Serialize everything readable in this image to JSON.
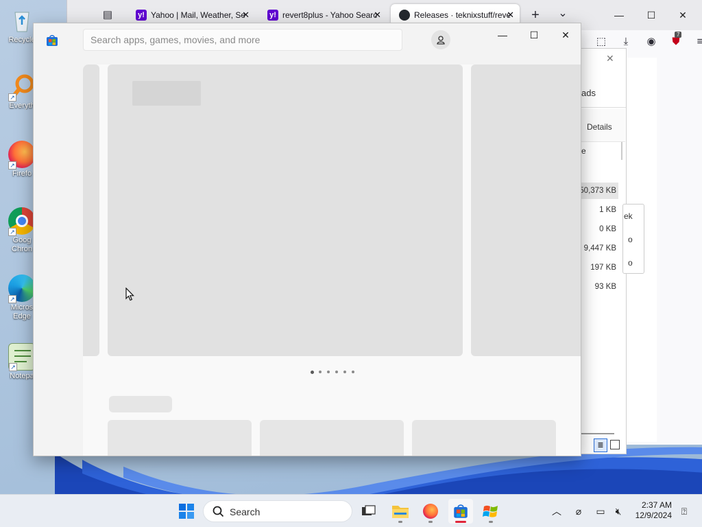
{
  "desktop": {
    "icons": [
      {
        "label": "Recycle",
        "icon": "recycle-bin-icon"
      },
      {
        "label": "Everyth",
        "icon": "everything-search-icon"
      },
      {
        "label": "Firefo",
        "icon": "firefox-icon"
      },
      {
        "label": "Goog\nChron",
        "icon": "chrome-icon"
      },
      {
        "label": "Micros\nEdge",
        "icon": "edge-icon"
      },
      {
        "label": "Notepa",
        "icon": "notepad-icon"
      }
    ]
  },
  "firefox": {
    "tabs": [
      {
        "title": "Yahoo | Mail, Weather, Se",
        "favicon": "y!"
      },
      {
        "title": "revert8plus - Yahoo Searc",
        "favicon": "y!"
      },
      {
        "title": "Releases · teknixstuff/reve",
        "favicon": "github-icon"
      }
    ],
    "new_tab": "+",
    "tab_list": "⌄",
    "minimize": "—",
    "maximize": "☐",
    "close": "✕",
    "extension_badge": "7",
    "downloads_panel": {
      "close": "✕",
      "title_fragment": "ads",
      "details_tab": "Details",
      "column_fragment": "e",
      "button_fragments": [
        "ek",
        "o",
        "o"
      ],
      "sizes": [
        "50,373 KB",
        "1 KB",
        "0 KB",
        "9,447 KB",
        "197 KB",
        "93 KB"
      ]
    }
  },
  "store": {
    "search_placeholder": "Search apps, games, movies, and more",
    "minimize": "—",
    "maximize": "☐",
    "close": "✕",
    "carousel_pages": 6,
    "carousel_active": 0
  },
  "taskbar": {
    "search_label": "Search",
    "time": "2:37 AM",
    "date": "12/9/2024",
    "accent": "#e0263a"
  }
}
